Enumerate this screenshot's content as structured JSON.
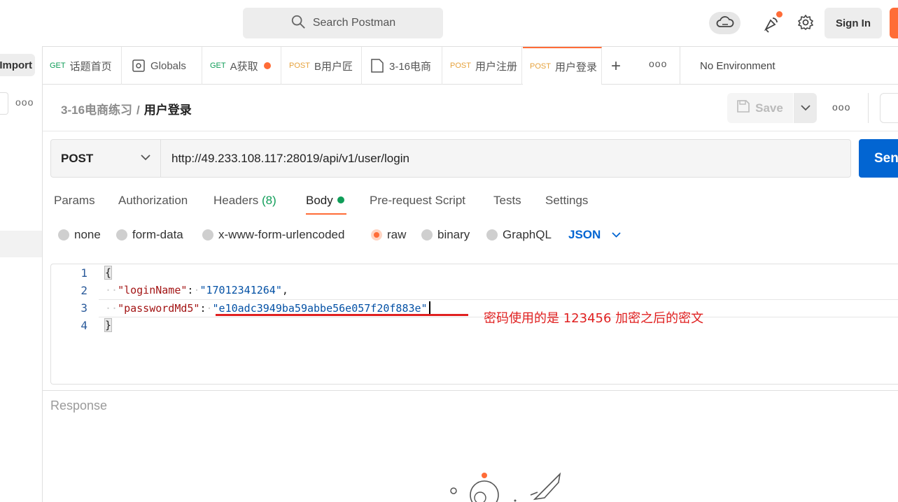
{
  "topbar": {
    "search_placeholder": "Search Postman",
    "sign_in": "Sign In",
    "icons": [
      "cloud-sync-icon",
      "satellite-icon",
      "gear-icon",
      "search-icon"
    ],
    "accent": "#ff6c37"
  },
  "sidebar": {
    "import_label": "Import",
    "more": "ooo"
  },
  "tabs": [
    {
      "method": "GET",
      "label": "话题首页"
    },
    {
      "method": "",
      "label": "Globals"
    },
    {
      "method": "GET",
      "label": "A获取"
    },
    {
      "method": "POST",
      "label": "B用户匠"
    },
    {
      "method": "",
      "label": "3-16电商"
    },
    {
      "method": "POST",
      "label": "用户注册"
    },
    {
      "method": "POST",
      "label": "用户登录"
    }
  ],
  "environment": "No Environment",
  "breadcrumb": {
    "parent": "3-16电商练习",
    "sep": "/",
    "current": "用户登录"
  },
  "save_label": "Save",
  "request": {
    "method": "POST",
    "url": "http://49.233.108.117:28019/api/v1/user/login",
    "send_label": "Send"
  },
  "request_tabs": {
    "params": "Params",
    "authorization": "Authorization",
    "headers": "Headers",
    "headers_count": "(8)",
    "body": "Body",
    "prerequest": "Pre-request Script",
    "tests": "Tests",
    "settings": "Settings"
  },
  "body_types": {
    "none": "none",
    "form_data": "form-data",
    "urlencoded": "x-www-form-urlencoded",
    "raw": "raw",
    "binary": "binary",
    "graphql": "GraphQL",
    "selected": "raw",
    "format": "JSON"
  },
  "editor": {
    "line_numbers": [
      "1",
      "2",
      "3",
      "4"
    ],
    "open_brace": "{",
    "close_brace": "}",
    "key1": "\"loginName\"",
    "val1": "\"17012341264\"",
    "key2": "\"passwordMd5\"",
    "val2": "\"e10adc3949ba59abbe56e057f20f883e\""
  },
  "annotation": "密码使用的是 123456 加密之后的密文",
  "response_label": "Response"
}
